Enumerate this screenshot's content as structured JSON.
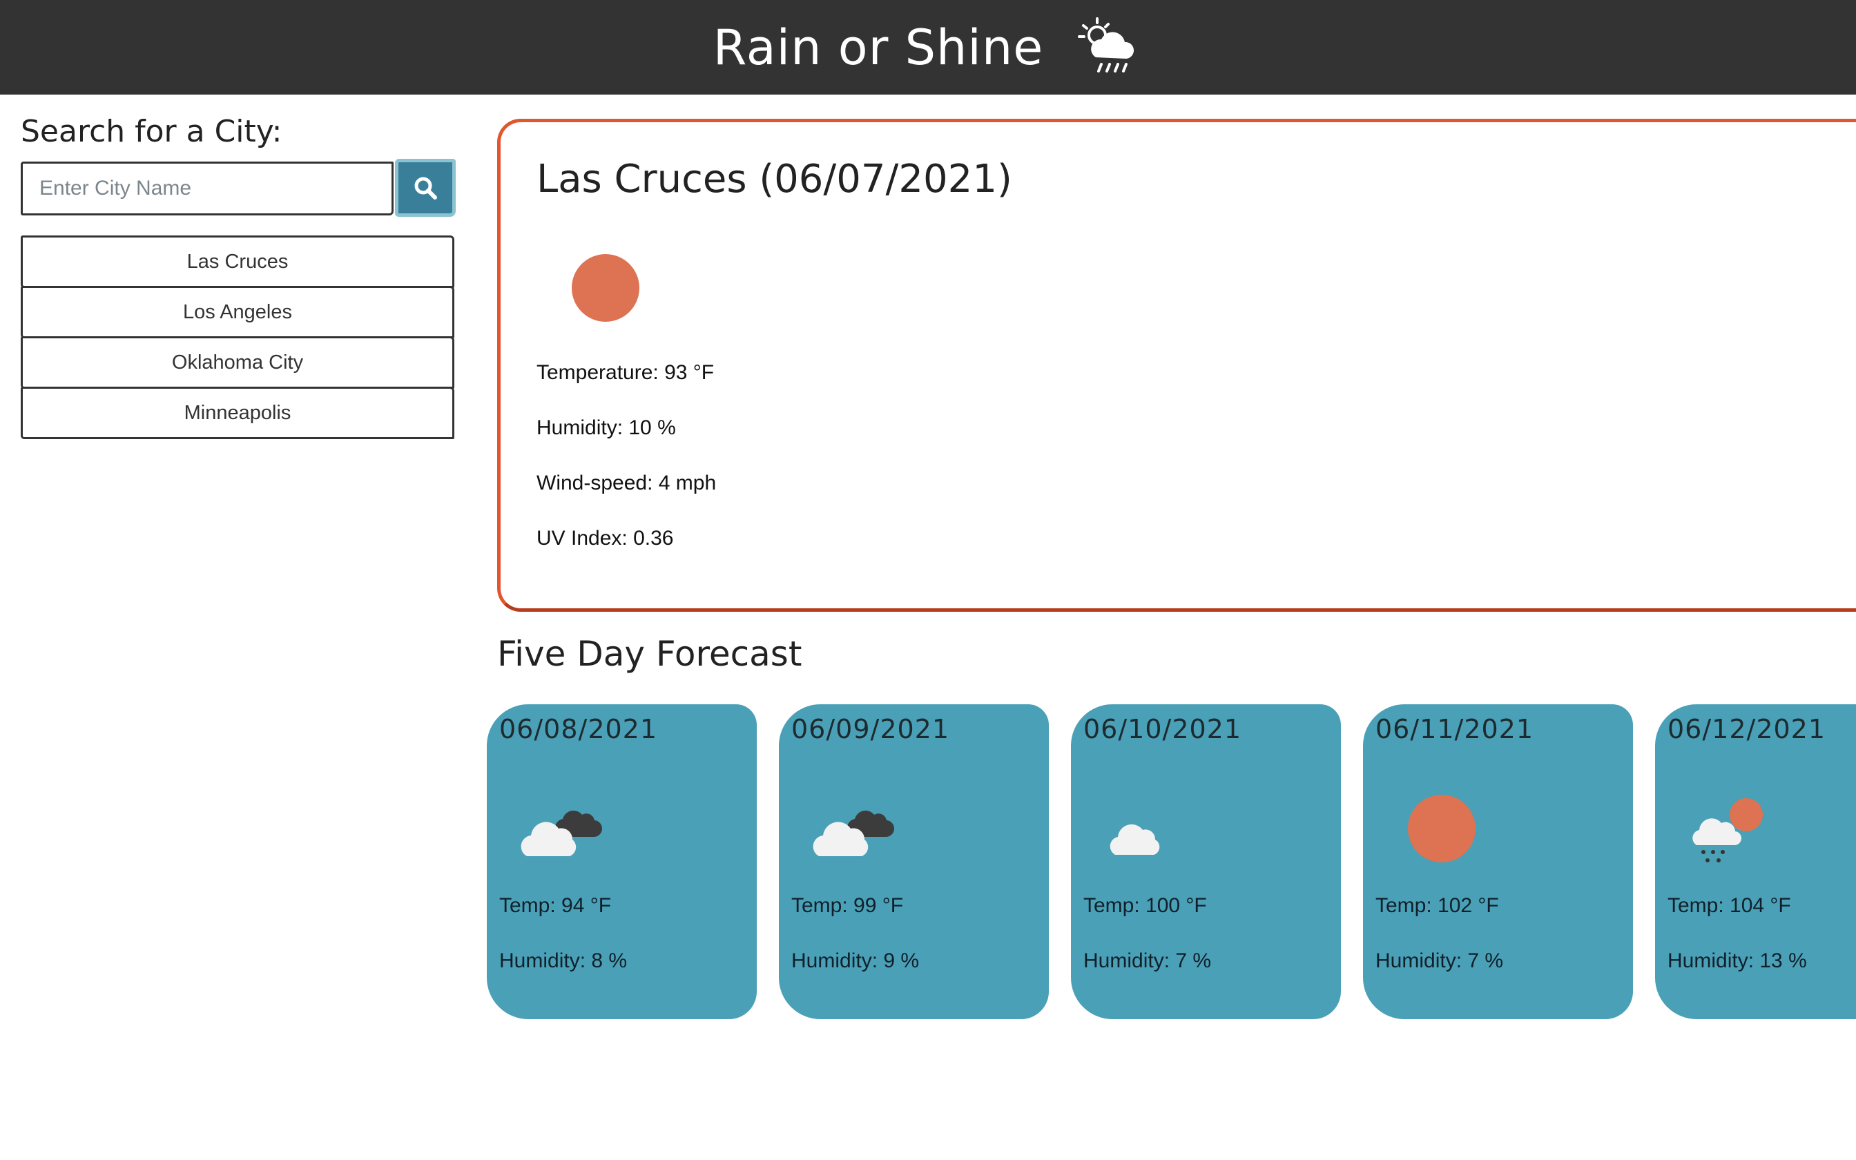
{
  "app": {
    "title": "Rain or Shine",
    "icon": "sun-cloud-rain-icon"
  },
  "search": {
    "label": "Search for a City:",
    "placeholder": "Enter City Name",
    "value": "",
    "button_icon": "search-icon"
  },
  "history": [
    {
      "label": "Las Cruces"
    },
    {
      "label": "Los Angeles"
    },
    {
      "label": "Oklahoma City"
    },
    {
      "label": "Minneapolis"
    }
  ],
  "current": {
    "title": "Las Cruces (06/07/2021)",
    "icon": "sun-icon",
    "temperature": "Temperature: 93 °F",
    "humidity": "Humidity: 10 %",
    "wind": "Wind-speed: 4 mph",
    "uv": "UV Index: 0.36"
  },
  "forecast": {
    "heading": "Five Day Forecast",
    "days": [
      {
        "date": "06/08/2021",
        "icon": "broken-clouds-icon",
        "temp": "Temp: 94 °F",
        "humidity": "Humidity: 8 %"
      },
      {
        "date": "06/09/2021",
        "icon": "broken-clouds-icon",
        "temp": "Temp: 99 °F",
        "humidity": "Humidity: 9 %"
      },
      {
        "date": "06/10/2021",
        "icon": "cloud-icon",
        "temp": "Temp: 100 °F",
        "humidity": "Humidity: 7 %"
      },
      {
        "date": "06/11/2021",
        "icon": "sun-icon",
        "temp": "Temp: 102 °F",
        "humidity": "Humidity: 7 %"
      },
      {
        "date": "06/12/2021",
        "icon": "sun-rain-cloud-icon",
        "temp": "Temp: 104 °F",
        "humidity": "Humidity: 13 %"
      }
    ]
  },
  "colors": {
    "header_bg": "#333333",
    "accent_orange": "#e0562f",
    "card_blue": "#4aa0b7",
    "sun": "#dd7352",
    "button_blue": "#3a7f99"
  }
}
